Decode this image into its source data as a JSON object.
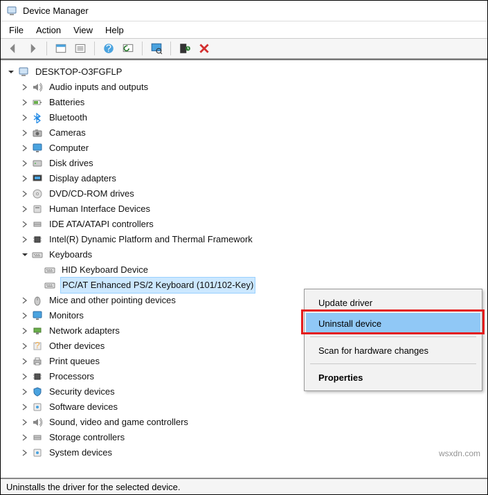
{
  "titlebar": {
    "title": "Device Manager"
  },
  "menubar": {
    "file": "File",
    "action": "Action",
    "view": "View",
    "help": "Help"
  },
  "tree": {
    "root": "DESKTOP-O3FGFLP",
    "audio": "Audio inputs and outputs",
    "batteries": "Batteries",
    "bluetooth": "Bluetooth",
    "cameras": "Cameras",
    "computer": "Computer",
    "disk": "Disk drives",
    "display": "Display adapters",
    "dvd": "DVD/CD-ROM drives",
    "hid": "Human Interface Devices",
    "ide": "IDE ATA/ATAPI controllers",
    "intel": "Intel(R) Dynamic Platform and Thermal Framework",
    "keyboards": "Keyboards",
    "kb_hid": "HID Keyboard Device",
    "kb_ps2": "PC/AT Enhanced PS/2 Keyboard (101/102-Key)",
    "mice": "Mice and other pointing devices",
    "monitors": "Monitors",
    "network": "Network adapters",
    "other": "Other devices",
    "print": "Print queues",
    "processors": "Processors",
    "security": "Security devices",
    "software": "Software devices",
    "sound": "Sound, video and game controllers",
    "storage": "Storage controllers",
    "system": "System devices"
  },
  "context_menu": {
    "update": "Update driver",
    "uninstall": "Uninstall device",
    "scan": "Scan for hardware changes",
    "properties": "Properties"
  },
  "statusbar": {
    "text": "Uninstalls the driver for the selected device."
  },
  "watermark": "wsxdn.com"
}
